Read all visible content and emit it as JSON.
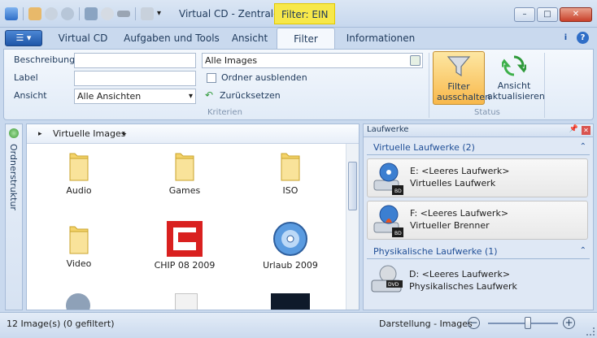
{
  "window": {
    "title": "Virtual CD - Zentrale",
    "filter_badge": "Filter: EIN",
    "controls": {
      "minimize": "–",
      "maximize": "□",
      "close": "✕"
    }
  },
  "tabs": [
    {
      "label": "Virtual CD"
    },
    {
      "label": "Aufgaben und Tools"
    },
    {
      "label": "Ansicht"
    },
    {
      "label": "Filter"
    },
    {
      "label": "Informationen"
    }
  ],
  "ribbon": {
    "criteria": {
      "beschreibung_label": "Beschreibung",
      "beschreibung_value": "",
      "label_label": "Label",
      "label_value": "",
      "ansicht_label": "Ansicht",
      "ansicht_value": "Alle Ansichten",
      "images_value": "Alle Images",
      "hide_folders_label": "Ordner ausblenden",
      "reset_label": "Zurücksetzen",
      "group_label": "Kriterien"
    },
    "status": {
      "filter_off_label": "Filter ausschalten",
      "refresh_view_label": "Ansicht aktualisieren",
      "group_label": "Status"
    }
  },
  "left_strip": {
    "label": "Ordnerstruktur"
  },
  "content": {
    "breadcrumb": [
      "Virtuelle Images"
    ],
    "items": [
      {
        "label": "Audio",
        "icon": "folder-icon"
      },
      {
        "label": "Games",
        "icon": "folder-icon"
      },
      {
        "label": "ISO",
        "icon": "folder-icon"
      },
      {
        "label": "Video",
        "icon": "folder-icon"
      },
      {
        "label": "CHIP 08 2009",
        "icon": "chip-logo-icon"
      },
      {
        "label": "Urlaub 2009",
        "icon": "bluray-disc-icon"
      }
    ]
  },
  "drives": {
    "title": "Laufwerke",
    "virtual_section": "Virtuelle Laufwerke (2)",
    "virtual": [
      {
        "line1": "E: <Leeres Laufwerk>",
        "line2": "Virtuelles Laufwerk"
      },
      {
        "line1": "F: <Leeres Laufwerk>",
        "line2": "Virtueller Brenner"
      }
    ],
    "physical_section": "Physikalische Laufwerke (1)",
    "physical": [
      {
        "line1": "D: <Leeres Laufwerk>",
        "line2": "Physikalisches Laufwerk"
      }
    ]
  },
  "statusbar": {
    "left": "12 Image(s) (0 gefiltert)",
    "right": "Darstellung - Images"
  },
  "colors": {
    "filter_badge": "#f7e84a",
    "chip_red": "#d9201f",
    "section_blue": "#1f4e96"
  }
}
